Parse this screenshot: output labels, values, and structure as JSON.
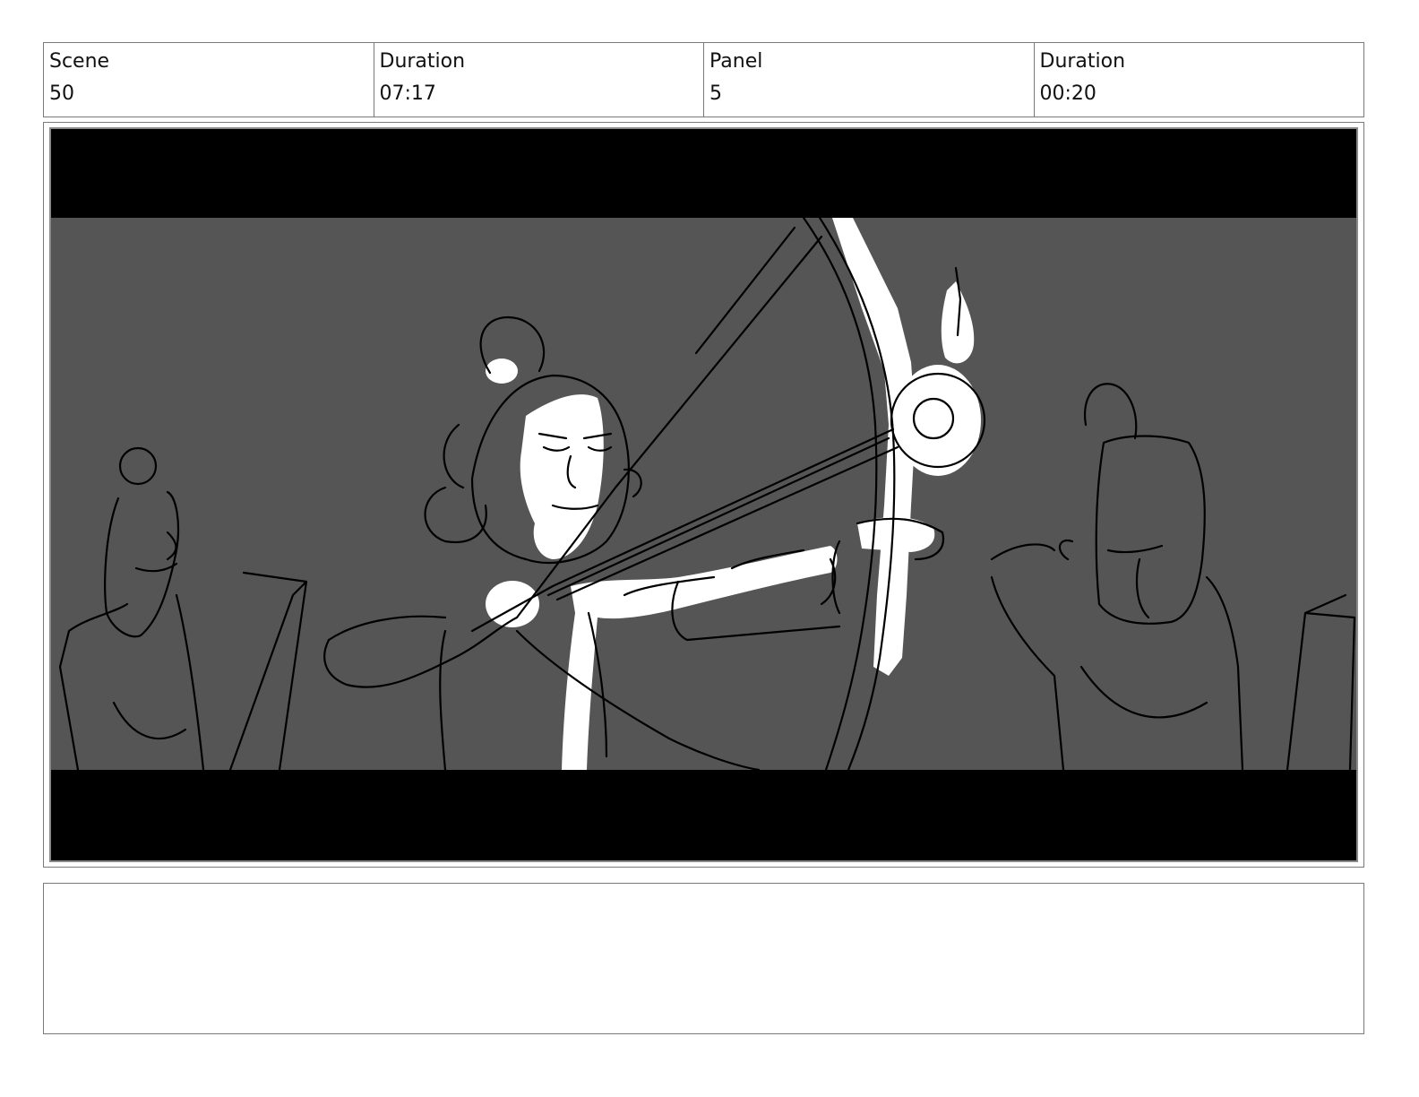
{
  "header": {
    "cells": [
      {
        "label": "Scene",
        "value": "50"
      },
      {
        "label": "Duration",
        "value": "07:17"
      },
      {
        "label": "Panel",
        "value": "5"
      },
      {
        "label": "Duration",
        "value": "00:20"
      }
    ]
  },
  "panel": {
    "sketch_background": "#555555",
    "letterbox_color": "#000000",
    "highlight_color": "#ffffff"
  },
  "notes": {
    "text": ""
  }
}
